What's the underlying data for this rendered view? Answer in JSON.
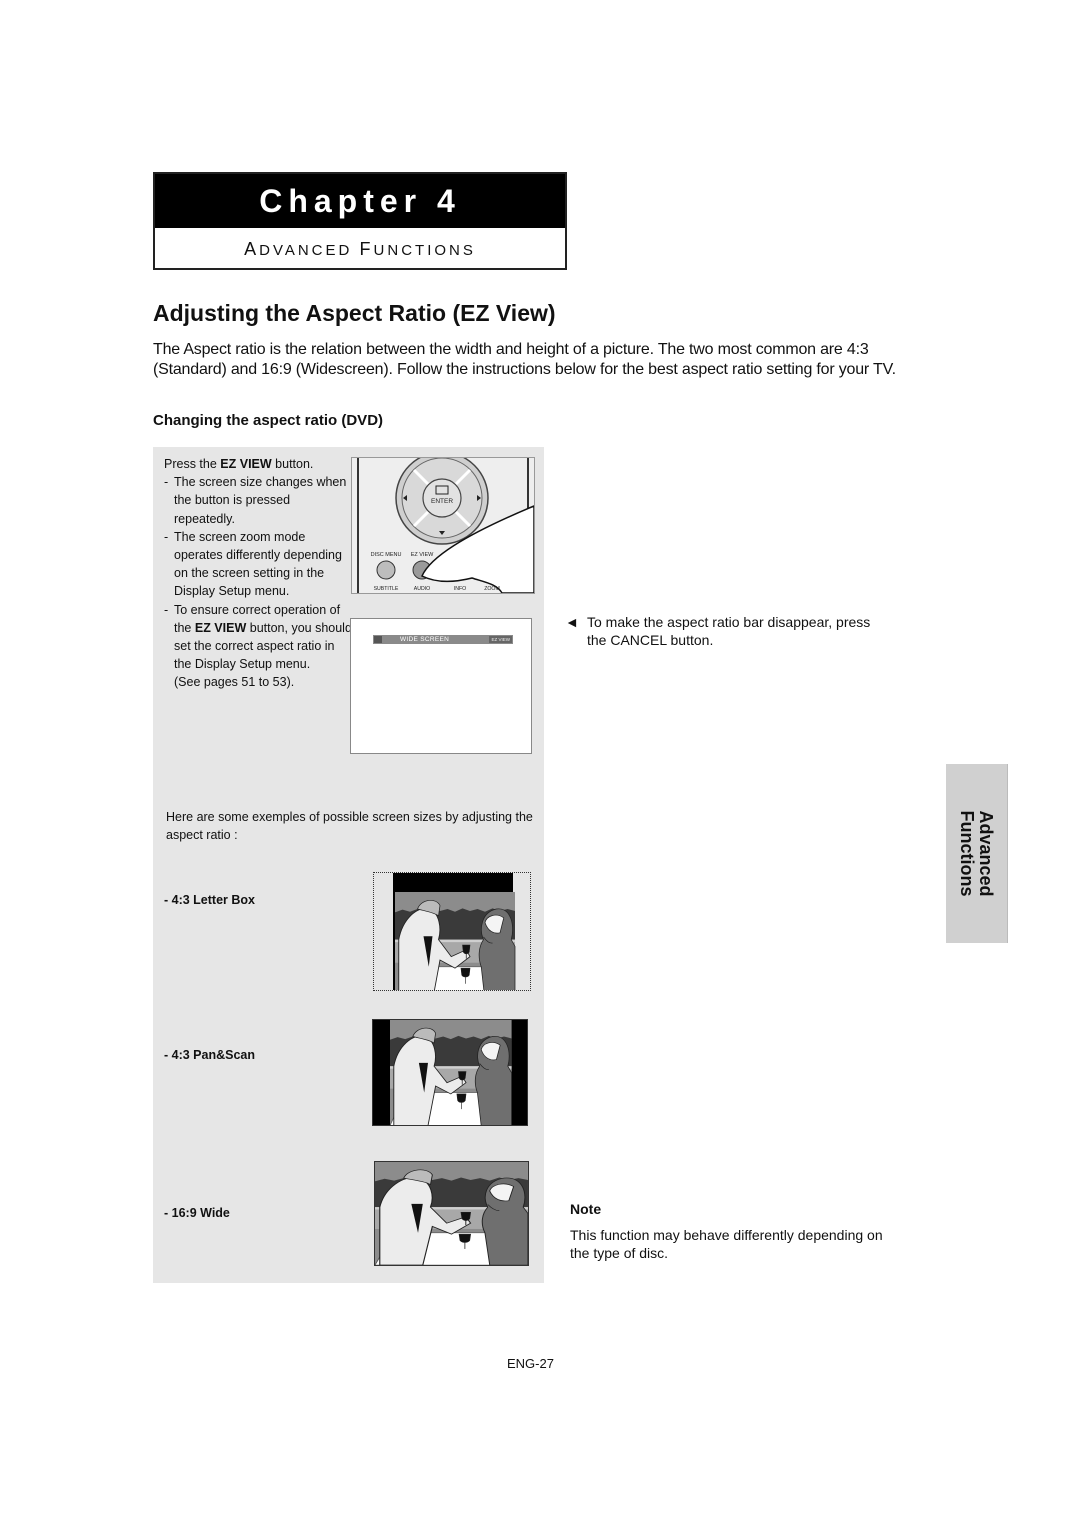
{
  "chapter": {
    "title": "Chapter 4",
    "subtitle": "Advanced Functions"
  },
  "section": {
    "title": "Adjusting the Aspect Ratio (EZ View)",
    "intro": "The Aspect ratio is the relation between the width and height of a picture. The two most common are 4:3 (Standard) and 16:9 (Widescreen). Follow the instructions below for the best aspect ratio setting for your TV.",
    "subheading": "Changing the aspect ratio (DVD)"
  },
  "steps": {
    "press_prefix": "Press the ",
    "press_button": "EZ VIEW",
    "press_suffix": " button.",
    "bullets": [
      "The screen size changes when the button is pressed repeatedly.",
      "The screen zoom mode operates differently depending on the screen setting in the Display Setup menu."
    ],
    "bullet3_prefix": "To ensure correct operation of the ",
    "bullet3_button": "EZ VIEW",
    "bullet3_suffix": " button, you should set the correct aspect ratio in the Display Setup menu.",
    "reference": "(See pages 51 to 53)."
  },
  "remote": {
    "enter_label": "ENTER",
    "top_labels": [
      "DISC MENU",
      "EZ VIEW"
    ],
    "bottom_labels": [
      "SUBTITLE",
      "AUDIO",
      "INFO",
      "ZOOM"
    ]
  },
  "screen_osd": {
    "mode_text": "WIDE SCREEN",
    "badge": "EZ VIEW"
  },
  "examples": {
    "intro": "Here are some exemples of possible screen sizes by adjusting the aspect ratio :",
    "items": [
      {
        "label": "- 4:3 Letter Box",
        "mode": "letterbox"
      },
      {
        "label": "- 4:3 Pan&Scan",
        "mode": "panscan"
      },
      {
        "label": "- 16:9 Wide",
        "mode": "wide"
      }
    ]
  },
  "cancel_note": {
    "arrow": "◄",
    "text": "To make the aspect ratio bar disappear, press the CANCEL button."
  },
  "note": {
    "title": "Note",
    "text": "This function may behave differently depending on the type of disc."
  },
  "side_tab": {
    "line1": "Advanced",
    "line2": "Functions"
  },
  "page_number": "ENG-27"
}
